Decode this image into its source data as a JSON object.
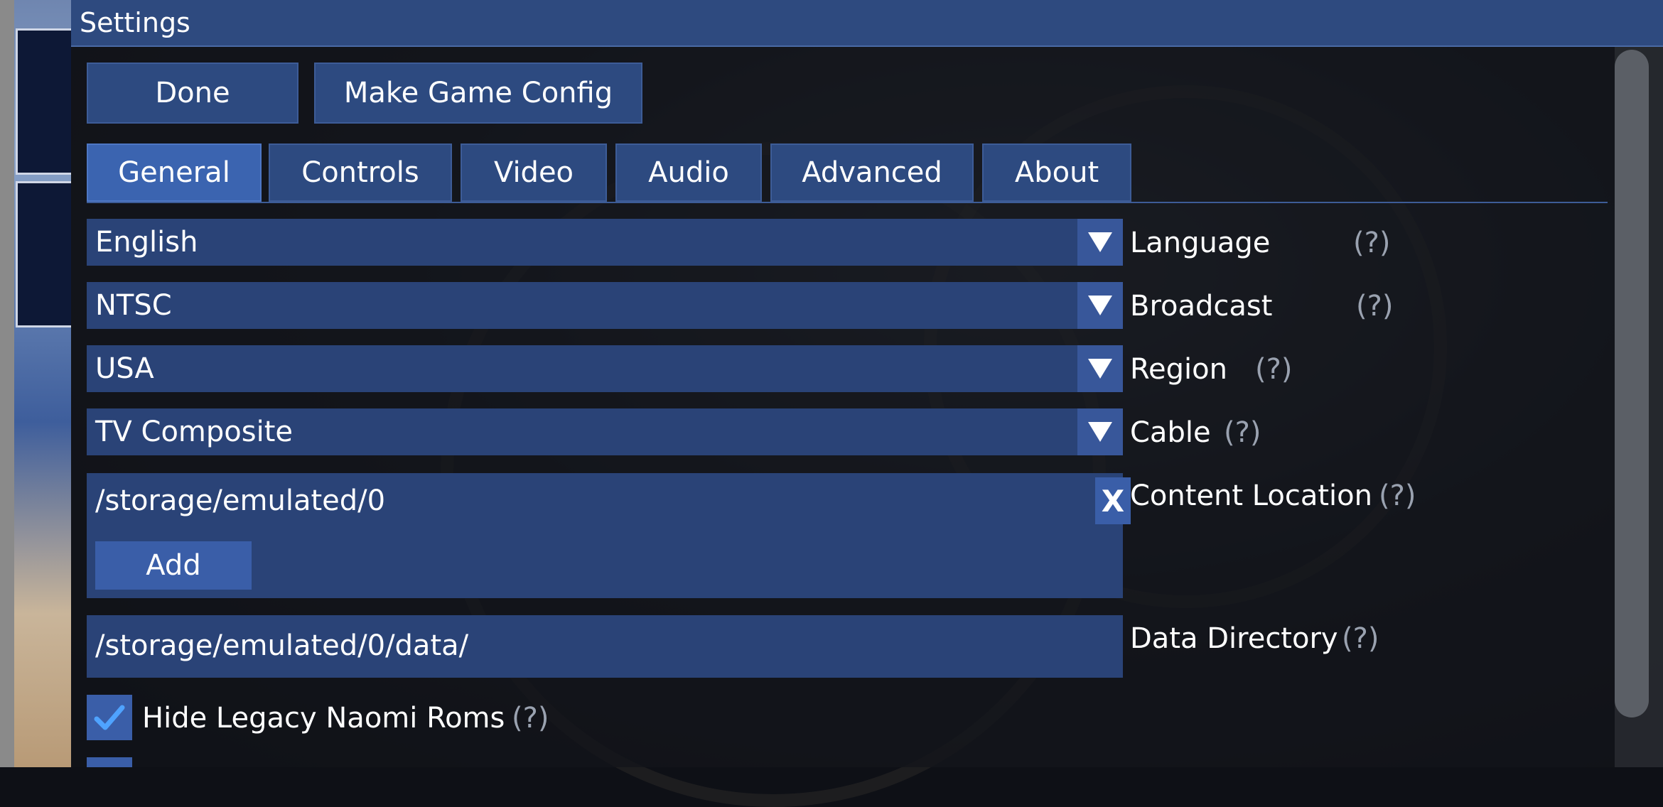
{
  "window": {
    "title": "Settings"
  },
  "toolbar": {
    "done_label": "Done",
    "make_game_config_label": "Make Game Config"
  },
  "tabs": [
    {
      "label": "General",
      "active": true
    },
    {
      "label": "Controls",
      "active": false
    },
    {
      "label": "Video",
      "active": false
    },
    {
      "label": "Audio",
      "active": false
    },
    {
      "label": "Advanced",
      "active": false
    },
    {
      "label": "About",
      "active": false
    }
  ],
  "general": {
    "language": {
      "value": "English",
      "label": "Language",
      "help": "(?)"
    },
    "broadcast": {
      "value": "NTSC",
      "label": "Broadcast",
      "help": "(?)"
    },
    "region": {
      "value": "USA",
      "label": "Region",
      "help": "(?)"
    },
    "cable": {
      "value": "TV Composite",
      "label": "Cable",
      "help": "(?)"
    },
    "content_location": {
      "path": "/storage/emulated/0",
      "remove_label": "X",
      "add_label": "Add",
      "label": "Content Location",
      "help": "(?)"
    },
    "data_directory": {
      "value": "/storage/emulated/0/data/",
      "label": "Data Directory",
      "help": "(?)"
    },
    "hide_legacy_naomi_roms": {
      "checked": true,
      "label": "Hide Legacy Naomi Roms",
      "help": "(?)"
    }
  },
  "icons": {
    "dropdown": "triangle-down-icon",
    "check": "checkmark-icon"
  },
  "colors": {
    "accent": "#3b64b0",
    "panel": "#2a4377",
    "titlebar": "#2e4a7f",
    "help_text": "#9aa2b0"
  }
}
